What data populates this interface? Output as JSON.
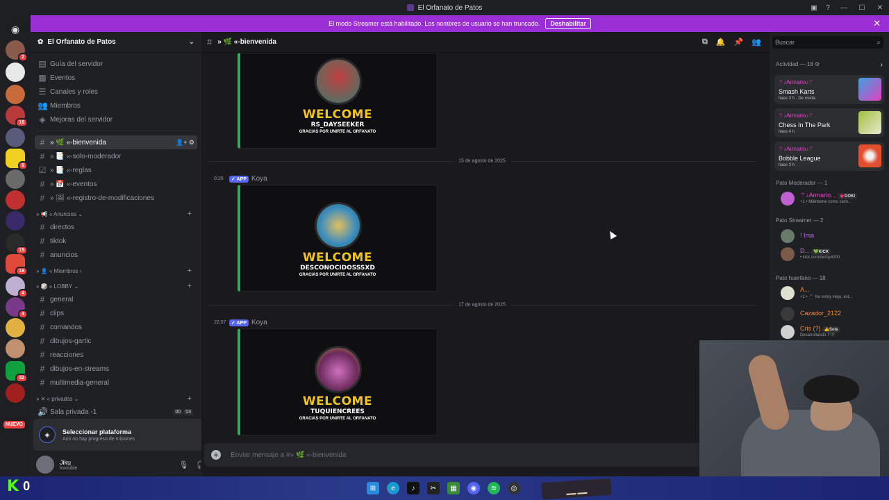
{
  "window": {
    "title": "El Orfanato de Patos"
  },
  "banner": {
    "text": "El modo Streamer está habilitado. Los nombres de usuario se han truncado.",
    "button": "Deshabilitar"
  },
  "server_rail": {
    "badges": [
      "2",
      "16",
      "6",
      "15",
      "18",
      "4",
      "4",
      "32"
    ],
    "nuevo": "NUEVO"
  },
  "server": {
    "name": "El Orfanato de Patos",
    "menu": [
      "Guía del servidor",
      "Eventos",
      "Canales y roles",
      "Miembros",
      "Mejoras del servidor"
    ],
    "channels_top": [
      "» 🌿 «-bienvenida",
      "» 📑 «-solo-moderador",
      "» 📑 «-reglas",
      "» 📅 «-eventos",
      "» 🖼 «-registro-de-modificaciones"
    ],
    "cat_anuncios": "» 📢 « Anuncios",
    "anuncios": [
      "directos",
      "tiktok",
      "anuncios"
    ],
    "cat_miembros": "» 👤 « Miembros",
    "cat_lobby": "» 🎲 « LOBBY",
    "lobby": [
      "general",
      "clips",
      "comandos",
      "dibujos-gartic",
      "reacciones",
      "dibujos-en-streams",
      "multimedia-general"
    ],
    "cat_privadas": "» ✕ « privadas",
    "voice": "Sala privada -1",
    "voice_count": [
      "00",
      "03"
    ]
  },
  "platform": {
    "title": "Seleccionar plataforma",
    "subtitle": "Aún no hay progreso de misiones"
  },
  "user": {
    "name": "Jiku",
    "status": "Invisible"
  },
  "channel_header": {
    "name": "» 🌿 «-bienvenida"
  },
  "messages": [
    {
      "welcome": "WELCOME",
      "username": "RS_DAYSEEKER",
      "tagline": "GRACIAS POR UNIRTE AL ORFANATO"
    },
    {
      "date": "15 de agosto de 2025",
      "time": "0:26",
      "app": "✓ APP",
      "author": "Koya",
      "welcome": "WELCOME",
      "username": "DESCONOCIDOSSSXD",
      "tagline": "GRACIAS POR UNIRTE AL ORFANATO"
    },
    {
      "date": "17 de agosto de 2025",
      "time": "22:07",
      "app": "✓ APP",
      "author": "Koya",
      "welcome": "WELCOME",
      "username": "TUQUIENCREES",
      "tagline": "GRACIAS POR UNIRTE AL ORFANATO"
    }
  ],
  "composer": {
    "placeholder": "Enviar mensaje a #» 🌿 «-bienvenida"
  },
  "members": {
    "search": "Buscar",
    "activity_header": "Actividad — 18 ⚙",
    "activities": [
      {
        "who": "⚚♪Armario♪⚚",
        "game": "Smash Karts",
        "when": "hace 3 h  · De moda"
      },
      {
        "who": "⚚♪Armario♪⚚",
        "game": "Chess In The Park",
        "when": "hace 4 h"
      },
      {
        "who": "⚚♪Armario♪⚚",
        "game": "Bobble League",
        "when": "hace 3 h"
      }
    ],
    "group_mod": "Pato Moderador — 1",
    "mod": {
      "name": "⚚♪Armario...",
      "tag": "💗DOKI",
      "status": "+1 • Miénteme como siem..."
    },
    "group_streamer": "Pato Streamer — 2",
    "streamers": [
      {
        "name": "! Ima",
        "tag": "",
        "status": ""
      },
      {
        "name": "D...",
        "tag": "💚KICK",
        "status": "• kick.com/derby4000"
      }
    ],
    "group_huerfano": "Pato huerfano — 18",
    "huerfanos": [
      {
        "name": "A...",
        "tag": "",
        "status": "+1 • 📱 No estoy viejo, est..."
      },
      {
        "name": "Cazador_2122",
        "tag": "",
        "status": ""
      },
      {
        "name": "Cris (?)",
        "tag": "👍Sols",
        "status": "Desarrollando TTF"
      }
    ]
  },
  "colors": {
    "accent": "#5865f2",
    "banner": "#9b2fd6",
    "welcome_yellow": "#f0c419",
    "online": "#23a55a"
  }
}
